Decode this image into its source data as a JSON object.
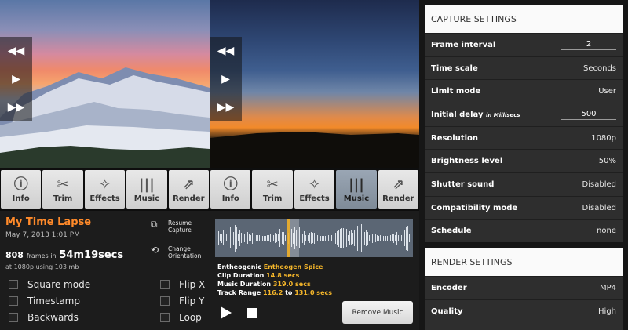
{
  "playback": {
    "rewind": "◀◀",
    "play": "▶",
    "forward": "▶▶"
  },
  "toolbar": {
    "buttons": [
      {
        "label": "Info",
        "icon": "ⓘ"
      },
      {
        "label": "Trim",
        "icon": "✂"
      },
      {
        "label": "Effects",
        "icon": "✧"
      },
      {
        "label": "Music",
        "icon": "|||"
      },
      {
        "label": "Render",
        "icon": "⇗"
      },
      {
        "label": "Info",
        "icon": "ⓘ"
      },
      {
        "label": "Trim",
        "icon": "✂"
      },
      {
        "label": "Effects",
        "icon": "✧"
      },
      {
        "label": "Music",
        "icon": "|||"
      },
      {
        "label": "Render",
        "icon": "⇗"
      }
    ],
    "active_index": 8
  },
  "project": {
    "title": "My Time Lapse",
    "date": "May 7, 2013 1:01 PM",
    "frames": "808",
    "frames_in": "frames in",
    "duration": "54m19secs",
    "resolution_info": "at 1080p using 103 mb"
  },
  "options": {
    "square_mode": "Square mode",
    "timestamp": "Timestamp",
    "backwards": "Backwards",
    "flip_x": "Flip X",
    "flip_y": "Flip Y",
    "loop": "Loop"
  },
  "actions": {
    "resume_capture_1": "Resume",
    "resume_capture_2": "Capture",
    "change_orientation_1": "Change",
    "change_orientation_2": "Orientation"
  },
  "music": {
    "artist": "Entheogenic",
    "track": "Entheogen Spice",
    "clip_label": "Clip Duration",
    "clip_value": "14.8 secs",
    "music_label": "Music Duration",
    "music_value": "319.0 secs",
    "range_label": "Track Range",
    "range_start": "116.2",
    "range_to": "to",
    "range_end": "131.0 secs",
    "remove_label": "Remove Music"
  },
  "capture_settings": {
    "header": "CAPTURE SETTINGS",
    "frame_interval": {
      "label": "Frame interval",
      "value": "2"
    },
    "time_scale": {
      "label": "Time scale",
      "value": "Seconds"
    },
    "limit_mode": {
      "label": "Limit mode",
      "value": "User"
    },
    "initial_delay": {
      "label": "Initial delay",
      "sub": "in Millisecs",
      "value": "500"
    },
    "resolution": {
      "label": "Resolution",
      "value": "1080p"
    },
    "brightness": {
      "label": "Brightness level",
      "value": "50%"
    },
    "shutter": {
      "label": "Shutter sound",
      "value": "Disabled"
    },
    "compatibility": {
      "label": "Compatibility mode",
      "value": "Disabled"
    },
    "schedule": {
      "label": "Schedule",
      "value": "none"
    }
  },
  "render_settings": {
    "header": "RENDER SETTINGS",
    "encoder": {
      "label": "Encoder",
      "value": "MP4"
    },
    "quality": {
      "label": "Quality",
      "value": "High"
    }
  }
}
